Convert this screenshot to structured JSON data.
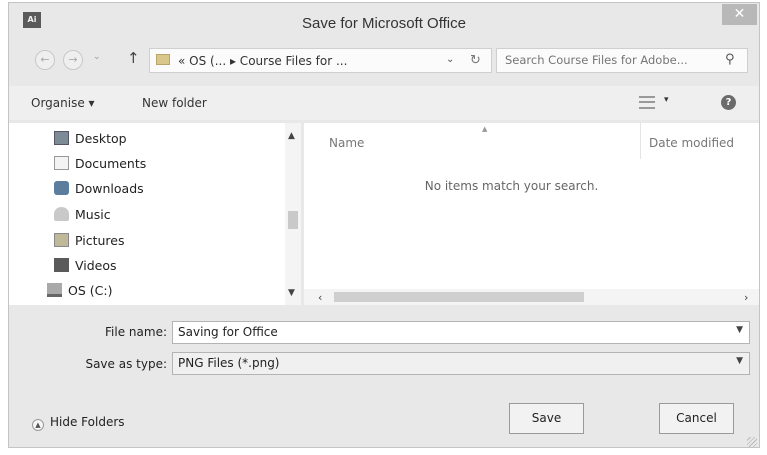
{
  "window": {
    "app_icon_text": "Ai",
    "title": "Save for Microsoft Office",
    "close_label": "✕"
  },
  "address_bar": {
    "back_glyph": "←",
    "forward_glyph": "→",
    "recent_glyph": "⌄",
    "up_glyph": "↑",
    "path": "« OS (... ▸ Course Files for ...",
    "dropdown_glyph": "⌄",
    "refresh_glyph": "↻"
  },
  "search": {
    "placeholder": "Search Course Files for Adobe...",
    "icon": "search-icon"
  },
  "toolbar": {
    "organise_label": "Organise ▾",
    "new_folder_label": "New folder",
    "view_dropdown": "▾",
    "help_label": "?"
  },
  "navigation": {
    "items": [
      {
        "label": "Desktop",
        "icon": "desktop-icon"
      },
      {
        "label": "Documents",
        "icon": "documents-icon"
      },
      {
        "label": "Downloads",
        "icon": "downloads-icon"
      },
      {
        "label": "Music",
        "icon": "music-icon"
      },
      {
        "label": "Pictures",
        "icon": "pictures-icon"
      },
      {
        "label": "Videos",
        "icon": "videos-icon"
      },
      {
        "label": "OS (C:)",
        "icon": "drive-icon"
      }
    ]
  },
  "file_list": {
    "columns": [
      "Name",
      "Date modified"
    ],
    "empty_message": "No items match your search."
  },
  "form": {
    "file_name_label": "File name:",
    "file_name_value": "Saving for Office",
    "save_type_label": "Save as type:",
    "save_type_value": "PNG Files (*.png)"
  },
  "footer": {
    "hide_folders_label": "Hide Folders",
    "save_label": "Save",
    "cancel_label": "Cancel"
  },
  "colors": {
    "dialog_background": "#e8e8e8",
    "close_button": "#b8b8b8"
  }
}
